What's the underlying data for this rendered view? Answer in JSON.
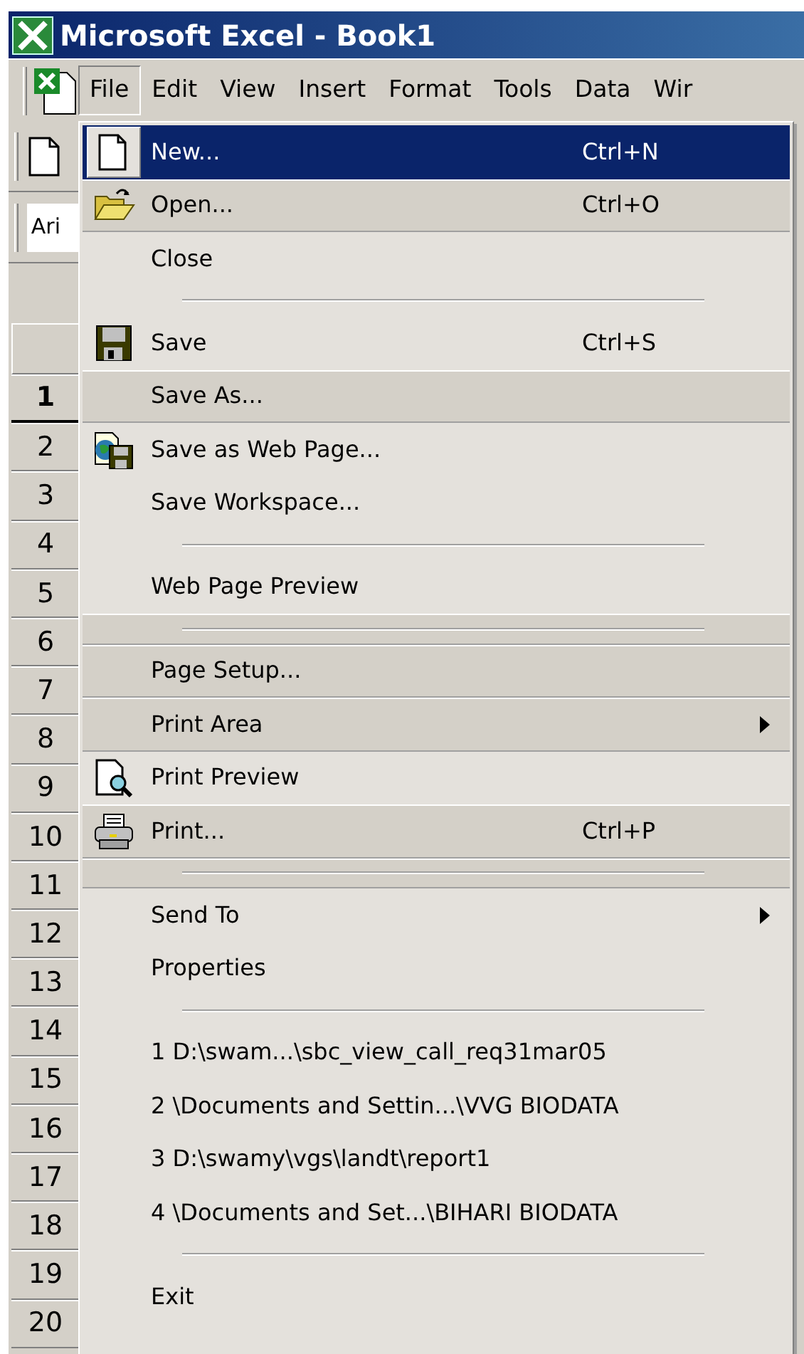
{
  "window": {
    "title": "Microsoft Excel - Book1"
  },
  "menu_bar": {
    "items": [
      {
        "label": "File",
        "selected": true
      },
      {
        "label": "Edit",
        "selected": false
      },
      {
        "label": "View",
        "selected": false
      },
      {
        "label": "Insert",
        "selected": false
      },
      {
        "label": "Format",
        "selected": false
      },
      {
        "label": "Tools",
        "selected": false
      },
      {
        "label": "Data",
        "selected": false
      },
      {
        "label": "Wir",
        "selected": false
      }
    ]
  },
  "toolbar": {
    "font_box": "Ari"
  },
  "row_headers": [
    {
      "label": "1",
      "selected": true
    },
    {
      "label": "2",
      "selected": false
    },
    {
      "label": "3",
      "selected": false
    },
    {
      "label": "4",
      "selected": false
    },
    {
      "label": "5",
      "selected": false
    },
    {
      "label": "6",
      "selected": false
    },
    {
      "label": "7",
      "selected": false
    },
    {
      "label": "8",
      "selected": false
    },
    {
      "label": "9",
      "selected": false
    },
    {
      "label": "10",
      "selected": false
    },
    {
      "label": "11",
      "selected": false
    },
    {
      "label": "12",
      "selected": false
    },
    {
      "label": "13",
      "selected": false
    },
    {
      "label": "14",
      "selected": false
    },
    {
      "label": "15",
      "selected": false
    },
    {
      "label": "16",
      "selected": false
    },
    {
      "label": "17",
      "selected": false
    },
    {
      "label": "18",
      "selected": false
    },
    {
      "label": "19",
      "selected": false
    },
    {
      "label": "20",
      "selected": false
    }
  ],
  "file_menu": {
    "items": [
      {
        "kind": "command",
        "label": "New...",
        "shortcut": "Ctrl+N",
        "submenu": false,
        "rarely_used": false,
        "selected": true
      },
      {
        "kind": "command",
        "label": "Open...",
        "shortcut": "Ctrl+O",
        "submenu": false,
        "rarely_used": true,
        "selected": false
      },
      {
        "kind": "command",
        "label": "Close",
        "submenu": false,
        "rarely_used": false,
        "selected": false
      },
      {
        "kind": "separator",
        "rarely_used": false
      },
      {
        "kind": "command",
        "label": "Save",
        "shortcut": "Ctrl+S",
        "submenu": false,
        "rarely_used": false,
        "selected": false
      },
      {
        "kind": "command",
        "label": "Save As...",
        "submenu": false,
        "rarely_used": true,
        "selected": false
      },
      {
        "kind": "command",
        "label": "Save as Web Page...",
        "submenu": false,
        "rarely_used": false,
        "selected": false
      },
      {
        "kind": "command",
        "label": "Save Workspace...",
        "submenu": false,
        "rarely_used": false,
        "selected": false
      },
      {
        "kind": "separator",
        "rarely_used": false
      },
      {
        "kind": "command",
        "label": "Web Page Preview",
        "submenu": false,
        "rarely_used": false,
        "selected": false
      },
      {
        "kind": "separator",
        "rarely_used": true
      },
      {
        "kind": "command",
        "label": "Page Setup...",
        "submenu": false,
        "rarely_used": true,
        "selected": false
      },
      {
        "kind": "command",
        "label": "Print Area",
        "submenu": true,
        "rarely_used": true,
        "selected": false
      },
      {
        "kind": "command",
        "label": "Print Preview",
        "submenu": false,
        "rarely_used": false,
        "selected": false
      },
      {
        "kind": "command",
        "label": "Print...",
        "shortcut": "Ctrl+P",
        "submenu": false,
        "rarely_used": true,
        "selected": false
      },
      {
        "kind": "separator",
        "rarely_used": true
      },
      {
        "kind": "command",
        "label": "Send To",
        "submenu": true,
        "rarely_used": false,
        "selected": false
      },
      {
        "kind": "command",
        "label": "Properties",
        "submenu": false,
        "rarely_used": false,
        "selected": false
      },
      {
        "kind": "separator",
        "rarely_used": false
      },
      {
        "kind": "command",
        "label": "1 D:\\swam...\\sbc_view_call_req31mar05",
        "submenu": false,
        "rarely_used": false,
        "selected": false
      },
      {
        "kind": "command",
        "label": "2 \\Documents and Settin...\\VVG BIODATA",
        "submenu": false,
        "rarely_used": false,
        "selected": false
      },
      {
        "kind": "command",
        "label": "3 D:\\swamy\\vgs\\landt\\report1",
        "submenu": false,
        "rarely_used": false,
        "selected": false
      },
      {
        "kind": "command",
        "label": "4 \\Documents and Set...\\BIHARI BIODATA",
        "submenu": false,
        "rarely_used": false,
        "selected": false
      },
      {
        "kind": "separator",
        "rarely_used": false
      },
      {
        "kind": "command",
        "label": "Exit",
        "submenu": false,
        "rarely_used": false,
        "selected": false
      }
    ]
  }
}
